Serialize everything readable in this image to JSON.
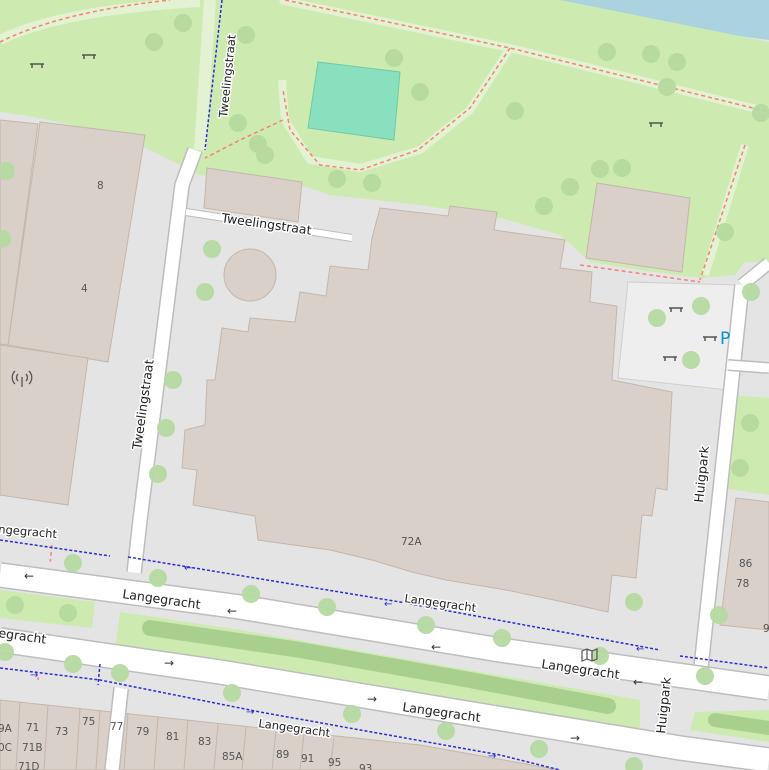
{
  "map": {
    "streets": {
      "tweelingstraat_north": "Tweelingstraat",
      "tweelingstraat_short": "Tweelingstraat",
      "tweelingstraat_vertical": "Tweelingstraat",
      "huigpark_north": "Huigpark",
      "huigpark_south": "Huigpark",
      "langegracht_west_top": "ngegracht",
      "langegracht_west_bottom": "egracht",
      "langegracht_upper": "Langegracht",
      "langegracht_upper_east": "Langegracht",
      "langegracht_service": "Langegracht",
      "langegracht_lower": "Langegracht",
      "langegracht_south": "Langegracht"
    },
    "house_numbers": {
      "n8": "8",
      "n4": "4",
      "n72a": "72A",
      "n86": "86",
      "n78": "78",
      "n9": "9",
      "n9a": "9A",
      "n71": "71",
      "n73": "73",
      "n75": "75",
      "n77": "77",
      "n79": "79",
      "n81": "81",
      "n83": "83",
      "n85a": "85A",
      "n89": "89",
      "n91": "91",
      "n95": "95",
      "n93": "93",
      "n0c": "0C",
      "n71b": "71B",
      "n71d": "71D"
    },
    "parking_symbol": "P",
    "oneway_arrow_left": "←",
    "oneway_arrow_right": "→",
    "colors": {
      "park": "#cdebb0",
      "building": "#d9d0c9",
      "road": "#ffffff",
      "pavement": "#dddde8",
      "water": "#aad3df",
      "pitch": "#88e0be",
      "footway": "#fa8072",
      "cycleway": "#0000ff",
      "parking": "#0092da"
    }
  }
}
